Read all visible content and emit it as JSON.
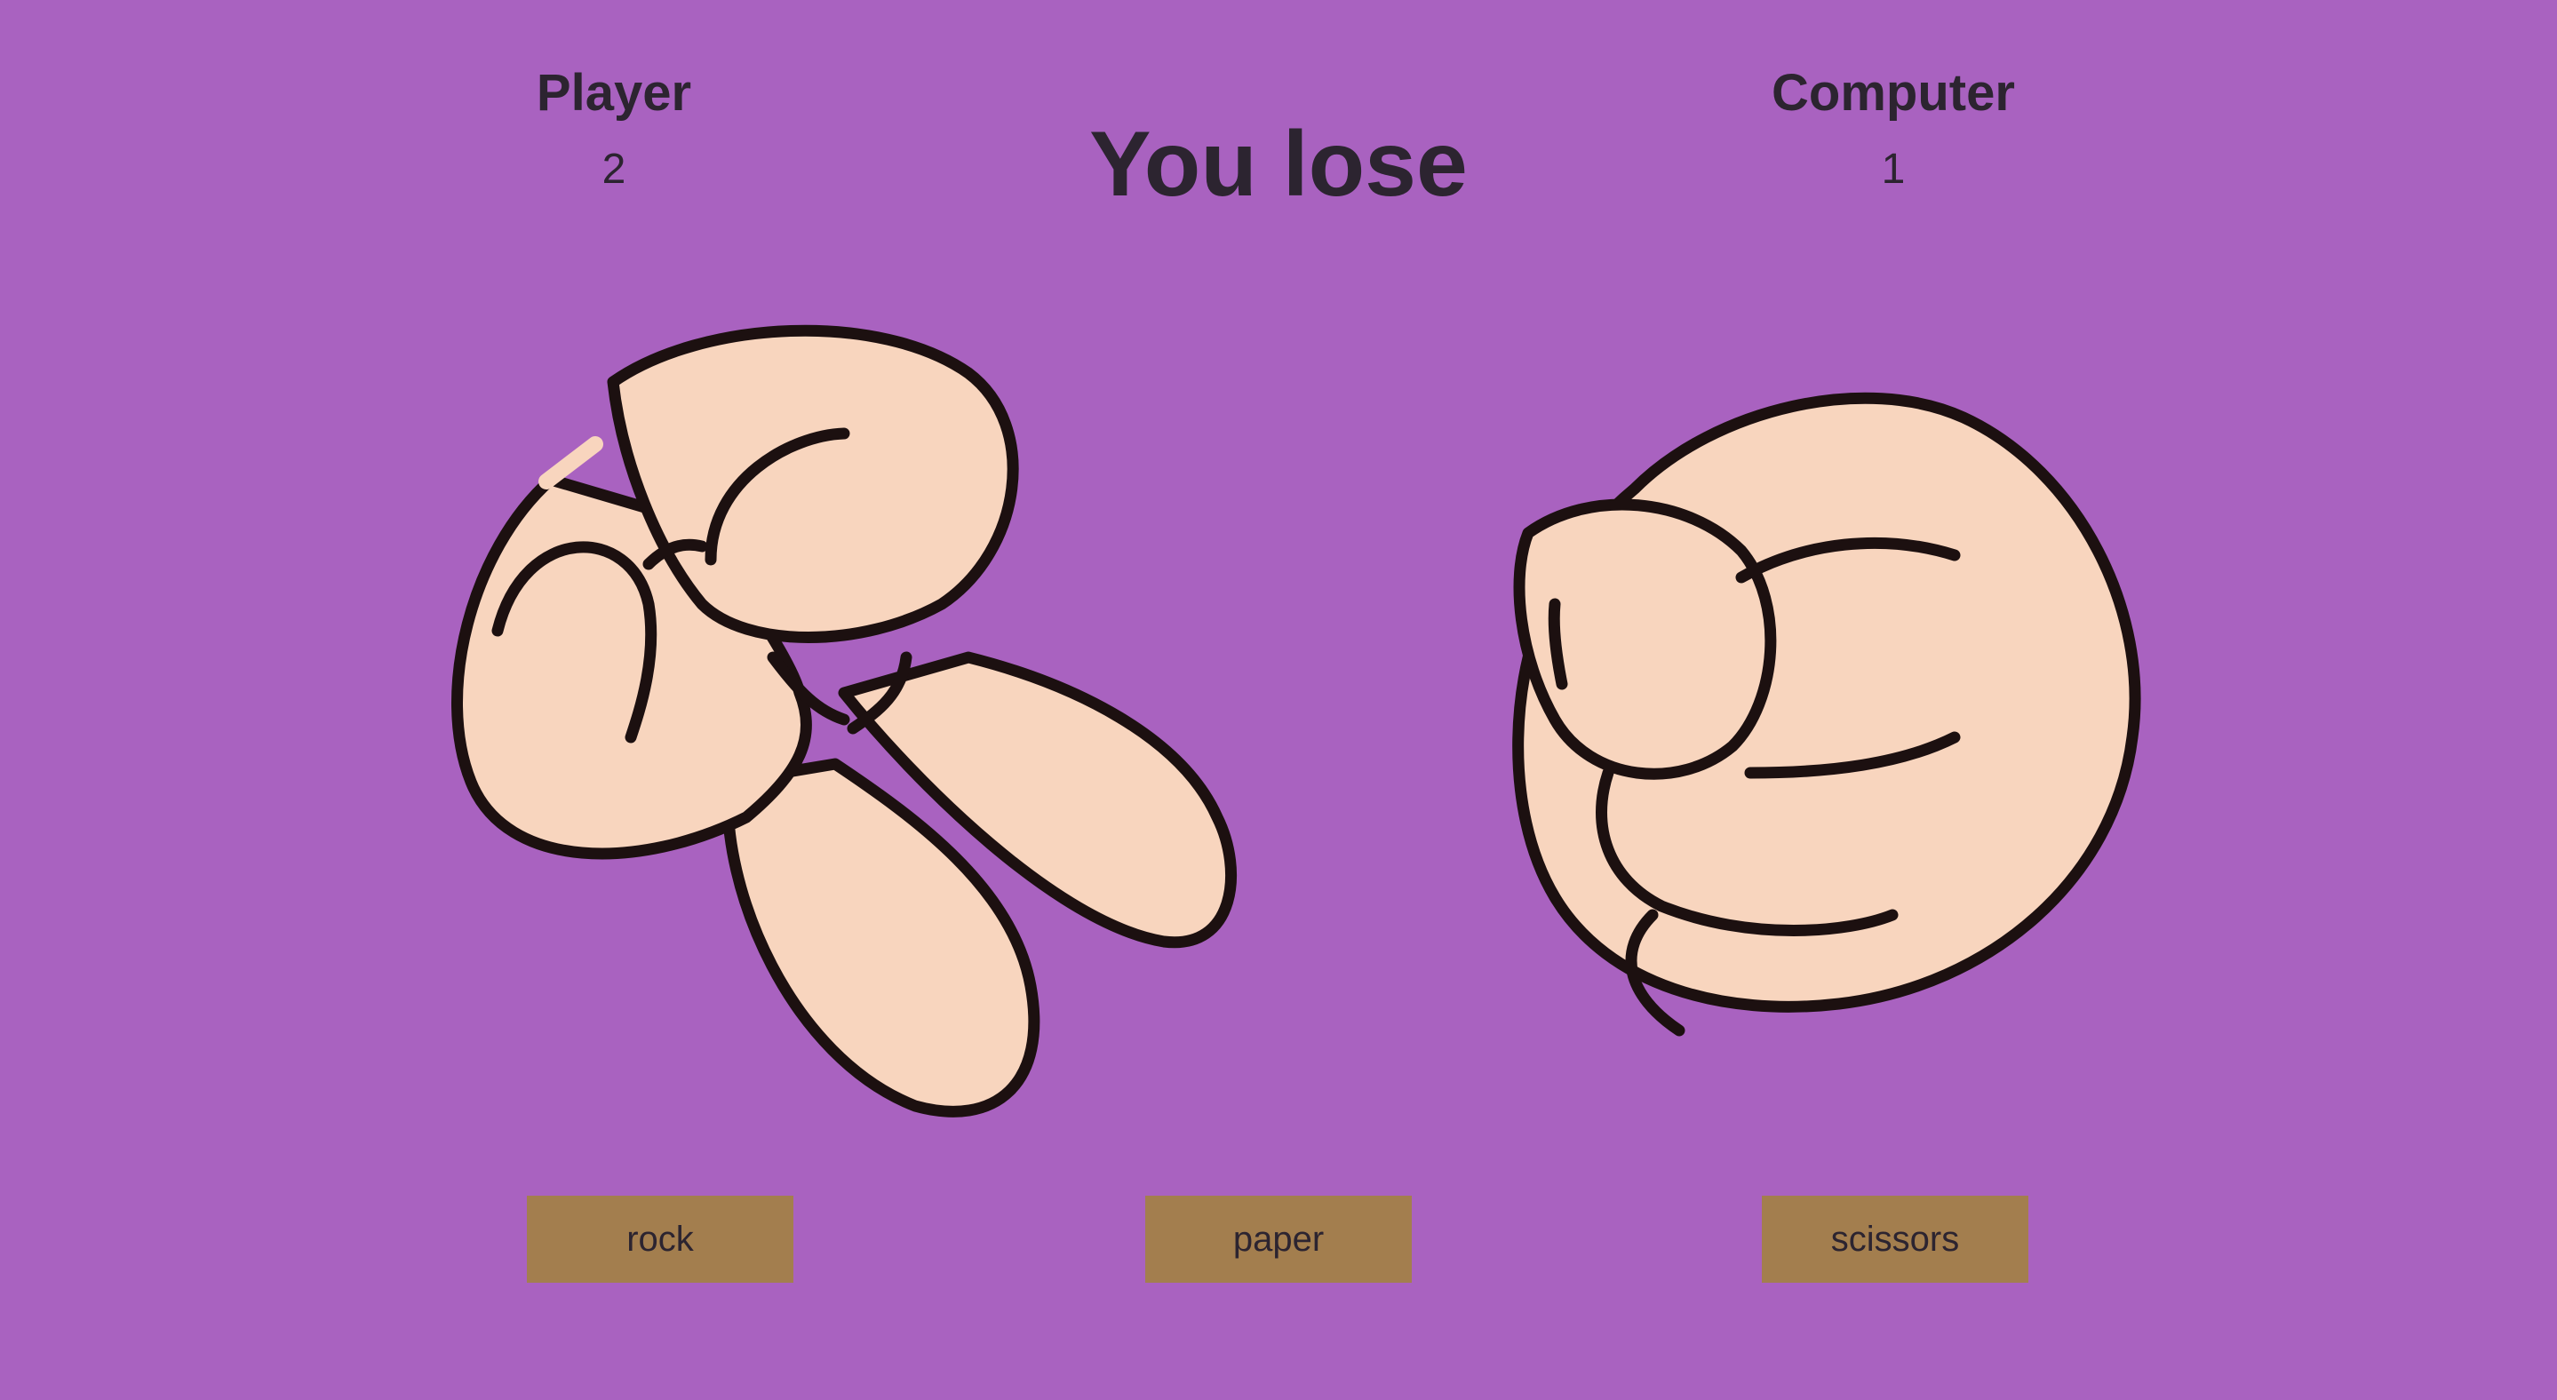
{
  "scoreboard": {
    "player_label": "Player",
    "player_score": "2",
    "computer_label": "Computer",
    "computer_score": "1"
  },
  "result": {
    "message": "You lose"
  },
  "hands": {
    "player_choice_icon": "scissors-hand-icon",
    "computer_choice_icon": "rock-fist-icon",
    "skin_color": "#f8d5be",
    "outline_color": "#1c1010"
  },
  "buttons": {
    "rock": "rock",
    "paper": "paper",
    "scissors": "scissors"
  },
  "colors": {
    "background": "#a962c0",
    "button": "#a37e4e",
    "text": "#2c2430"
  }
}
